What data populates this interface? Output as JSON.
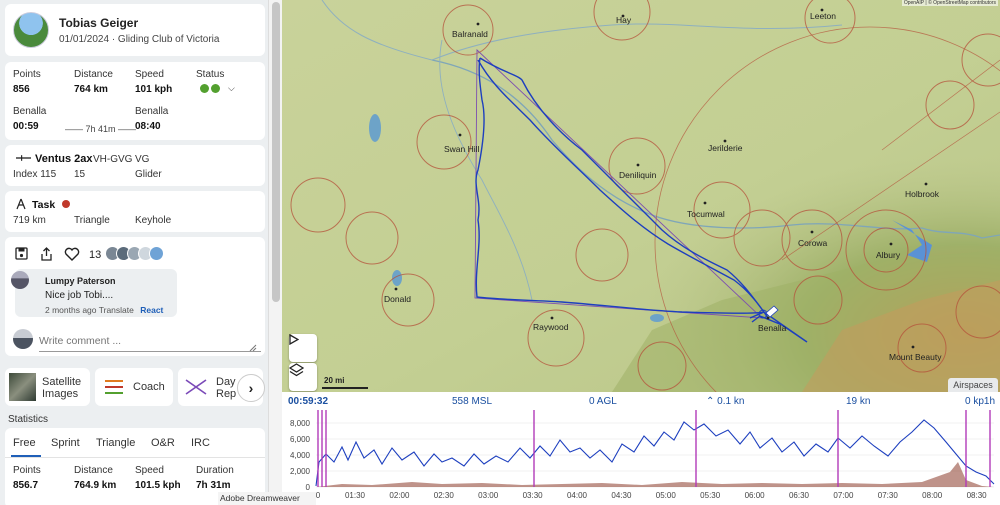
{
  "pilot": {
    "name": "Tobias Geiger",
    "date": "01/01/2024",
    "club": "Gliding Club of Victoria",
    "date_club": "01/01/2024 · Gliding Club of Victoria"
  },
  "flight": {
    "points_label": "Points",
    "points": "856",
    "distance_label": "Distance",
    "distance": "764 km",
    "speed_label": "Speed",
    "speed": "101 kph",
    "status_label": "Status",
    "takeoff_place": "Benalla",
    "takeoff_time": "00:59",
    "duration_line": "—— 7h 41m ——",
    "landing_place": "Benalla",
    "landing_time": "08:40"
  },
  "glider": {
    "type": "Ventus 2ax",
    "reg": "VH-GVG",
    "comp": "VG",
    "index_label": "Index 115",
    "index_value": "15",
    "category": "Glider"
  },
  "task": {
    "label": "Task",
    "distance": "719 km",
    "type": "Triangle",
    "sector": "Keyhole"
  },
  "social": {
    "likes": "13",
    "comment": {
      "author": "Lumpy Paterson",
      "text": "Nice job Tobi....",
      "age": "2 months ago",
      "translate": "Translate",
      "react": "React"
    },
    "write_placeholder": "Write comment ..."
  },
  "tools": [
    {
      "label": "Satellite Images"
    },
    {
      "label": "Coach"
    },
    {
      "label": "Day Rep"
    }
  ],
  "statistics": {
    "title": "Statistics",
    "tabs": [
      "Free",
      "Sprint",
      "Triangle",
      "O&R",
      "IRC"
    ],
    "labels": {
      "points": "Points",
      "distance": "Distance",
      "speed": "Speed",
      "duration": "Duration"
    },
    "values": {
      "points": "856.7",
      "distance": "764.9 km",
      "speed": "101.5 kph",
      "duration": "7h 31m"
    }
  },
  "map": {
    "attribution": "OpenAIP | © OpenStreetMap contributors",
    "scale": "20 mi",
    "airspaces_tab": "Airspaces",
    "towns": [
      "Balranald",
      "Hay",
      "Leeton",
      "Swan Hill",
      "Deniliquin",
      "Jerilderie",
      "Holbrook",
      "Tocumwal",
      "Corowa",
      "Albury",
      "Donald",
      "Raywood",
      "Benalla",
      "Mount Beauty"
    ]
  },
  "profile": {
    "time": "00:59:32",
    "msl": "558 MSL",
    "agl": "0 AGL",
    "climb": "0.1 kn",
    "wind": "19 kn",
    "speed": "0 kp1h",
    "y_ticks": [
      "8,000",
      "6,000",
      "4,000",
      "2,000",
      "0"
    ],
    "x_ticks": [
      "0",
      "01:30",
      "02:00",
      "02:30",
      "03:00",
      "03:30",
      "04:00",
      "04:30",
      "05:00",
      "05:30",
      "06:00",
      "06:30",
      "07:00",
      "07:30",
      "08:00",
      "08:30"
    ]
  },
  "taskbar_label": "Adobe Dreamweaver 2021",
  "colors": {
    "accent": "#1f5fb8",
    "track": "#1d3fbf",
    "status_green": "#53a02f",
    "task_red": "#c0392b",
    "airspace": "#b5523b"
  }
}
